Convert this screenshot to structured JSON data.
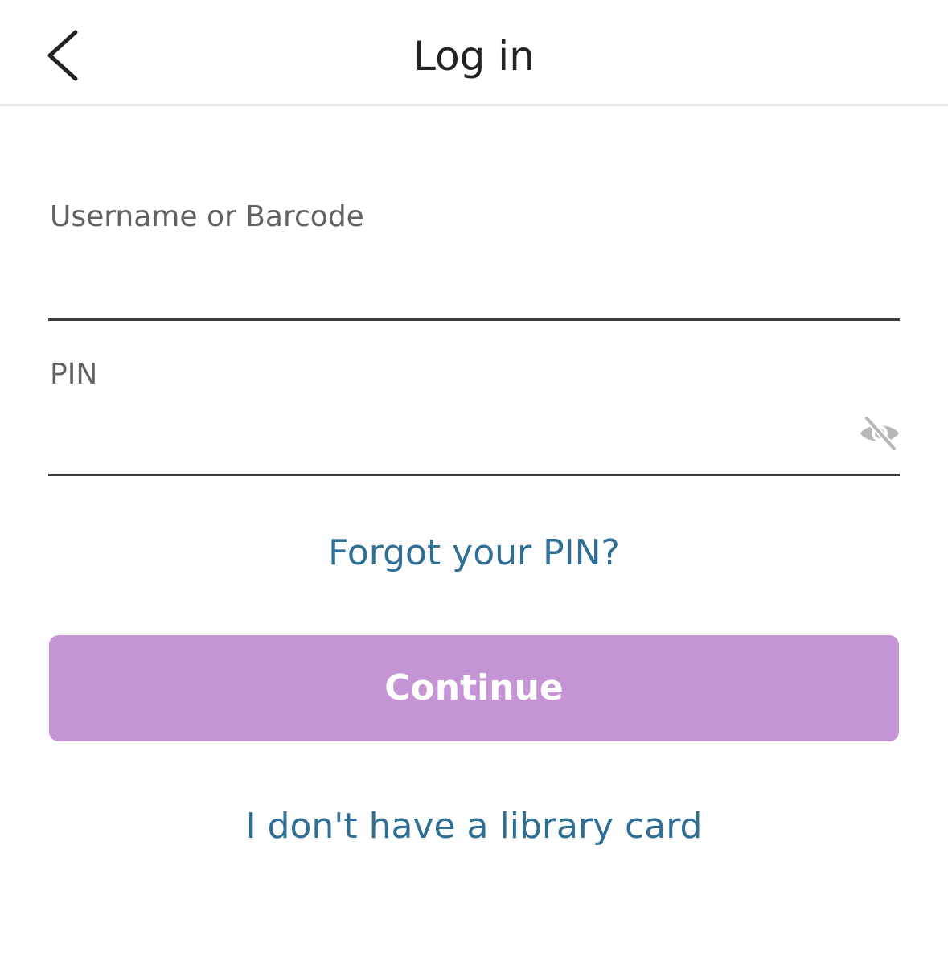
{
  "header": {
    "title": "Log in",
    "back_icon": "chevron-left-icon"
  },
  "form": {
    "username": {
      "label": "Username or Barcode",
      "value": "",
      "placeholder": ""
    },
    "pin": {
      "label": "PIN",
      "value": "",
      "placeholder": "",
      "visibility_icon": "eye-off-icon"
    }
  },
  "links": {
    "forgot_pin": "Forgot your PIN?",
    "no_library_card": "I don't have a library card"
  },
  "buttons": {
    "continue_label": "Continue"
  },
  "colors": {
    "link": "#2f6f96",
    "continue_button": "#c594d4",
    "input_underline": "#3d3d3d",
    "label": "#616161"
  }
}
